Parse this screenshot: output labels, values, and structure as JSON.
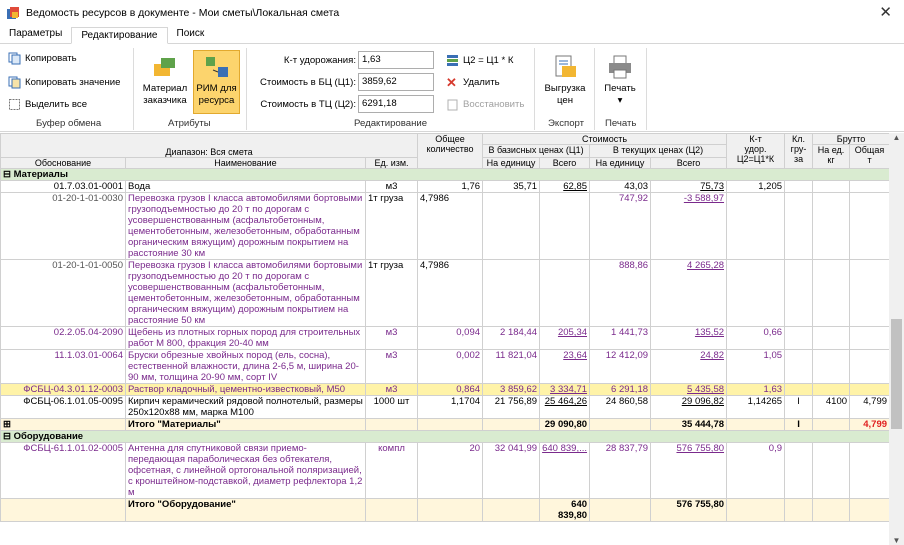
{
  "window": {
    "title": "Ведомость ресурсов в документе - Мои сметы\\Локальная смета",
    "close": "✕"
  },
  "tabs": [
    "Параметры",
    "Редактирование",
    "Поиск"
  ],
  "ribbon": {
    "clipboard": {
      "copy": "Копировать",
      "copy_value": "Копировать значение",
      "select_all": "Выделить все",
      "label": "Буфер обмена"
    },
    "attributes": {
      "material1": "Материал",
      "material2": "заказчика",
      "rim1": "РИМ для",
      "rim2": "ресурса",
      "label": "Атрибуты"
    },
    "editing": {
      "k_label": "К-т удорожания:",
      "k_value": "1,63",
      "bc_label": "Стоимость в БЦ (Ц1):",
      "bc_value": "3859,62",
      "tc_label": "Стоимость в ТЦ (Ц2):",
      "tc_value": "6291,18",
      "formula": "Ц2 = Ц1 * К",
      "delete": "Удалить",
      "restore": "Восстановить",
      "label": "Редактирование"
    },
    "export": {
      "l1": "Выгрузка",
      "l2": "цен",
      "label": "Экспорт"
    },
    "print": {
      "l1": "Печать",
      "label": "Печать"
    }
  },
  "grid": {
    "headers": {
      "range": "Диапазон: Вся смета",
      "basis": "Обоснование",
      "name": "Наименование",
      "unit": "Ед. изм.",
      "qty1": "Общее",
      "qty2": "количество",
      "cost": "Стоимость",
      "base": "В базисных ценах (Ц1)",
      "current": "В текущих ценах (Ц2)",
      "per_unit": "На единицу",
      "total": "Всего",
      "k1": "К-т",
      "k2": "удор.",
      "k3": "Ц2=Ц1*К",
      "kl1": "Кл.",
      "kl2": "гру-",
      "kl3": "за",
      "brutto": "Брутто",
      "per_kg1": "На ед.",
      "per_kg2": "кг",
      "all1": "Общая",
      "all2": "т"
    },
    "sec_materials": "Материалы",
    "sec_equipment": "Оборудование",
    "rows": [
      {
        "code": "01.7.03.01-0001",
        "name": "Вода",
        "unit": "м3",
        "qty": "1,76",
        "b_unit": "35,71",
        "b_total": "62,85",
        "c_unit": "43,03",
        "c_total": "75,73",
        "k": "1,205",
        "kl": "",
        "kg": "",
        "t": ""
      },
      {
        "code": "01-20-1-01-0030",
        "name": "Перевозка грузов I класса автомобилями бортовыми грузоподъемностью до 20 т по дорогам с усовершенствованным (асфальтобетонным, цементобетонным, железобетонным, обработанным органическим вяжущим) дорожным покрытием на расстояние 30 км",
        "unit": "1т груза",
        "qty": "4,7986",
        "b_unit": "",
        "b_total": "",
        "c_unit": "747,92",
        "c_total": "-3 588,97",
        "k": "",
        "kl": "",
        "kg": "",
        "t": ""
      },
      {
        "code": "01-20-1-01-0050",
        "name": "Перевозка грузов I класса автомобилями бортовыми грузоподъемностью до 20 т по дорогам с усовершенствованным (асфальтобетонным, цементобетонным, железобетонным, обработанным органическим вяжущим) дорожным покрытием на расстояние 50 км",
        "unit": "1т груза",
        "qty": "4,7986",
        "b_unit": "",
        "b_total": "",
        "c_unit": "888,86",
        "c_total": "4 265,28",
        "k": "",
        "kl": "",
        "kg": "",
        "t": ""
      },
      {
        "code": "02.2.05.04-2090",
        "name": "Щебень из плотных горных пород для строительных работ М 800, фракция 20-40 мм",
        "unit": "м3",
        "qty": "0,094",
        "b_unit": "2 184,44",
        "b_total": "205,34",
        "c_unit": "1 441,73",
        "c_total": "135,52",
        "k": "0,66",
        "kl": "",
        "kg": "",
        "t": ""
      },
      {
        "code": "11.1.03.01-0064",
        "name": "Бруски обрезные хвойных пород (ель, сосна), естественной влажности, длина 2-6,5 м, ширина 20-90 мм, толщина 20-90 мм, сорт IV",
        "unit": "м3",
        "qty": "0,002",
        "b_unit": "11 821,04",
        "b_total": "23,64",
        "c_unit": "12 412,09",
        "c_total": "24,82",
        "k": "1,05",
        "kl": "",
        "kg": "",
        "t": ""
      },
      {
        "code": "ФСБЦ-04.3.01.12-0003",
        "name": "Раствор кладочный, цементно-известковый, М50",
        "unit": "м3",
        "qty": "0,864",
        "b_unit": "3 859,62",
        "b_total": "3 334,71",
        "c_unit": "6 291,18",
        "c_total": "5 435,58",
        "k": "1,63",
        "kl": "",
        "kg": "",
        "t": ""
      },
      {
        "code": "ФСБЦ-06.1.01.05-0095",
        "name": "Кирпич керамический рядовой полнотелый, размеры 250х120х88 мм, марка М100",
        "unit": "1000 шт",
        "qty": "1,1704",
        "b_unit": "21 756,89",
        "b_total": "25 464,26",
        "c_unit": "24 860,58",
        "c_total": "29 096,82",
        "k": "1,14265",
        "kl": "I",
        "kg": "4100",
        "t": "4,799"
      }
    ],
    "total_materials": {
      "label": "Итого \"Материалы\"",
      "b_total": "29 090,80",
      "c_total": "35 444,78",
      "kl": "I",
      "t": "4,799"
    },
    "equip_rows": [
      {
        "code": "ФСБЦ-61.1.01.02-0005",
        "name": "Антенна для спутниковой связи приемо-передающая параболическая без обтекателя, офсетная, с линейной ортогональной поляризацией, с кронштейном-подставкой, диаметр рефлектора 1,2 м",
        "unit": "компл",
        "qty": "20",
        "b_unit": "32 041,99",
        "b_total": "640 839,...",
        "c_unit": "28 837,79",
        "c_total": "576 755,80",
        "k": "0,9"
      }
    ],
    "total_equipment": {
      "label": "Итого \"Оборудование\"",
      "b_total": "640 839,80",
      "c_total": "576 755,80"
    }
  }
}
